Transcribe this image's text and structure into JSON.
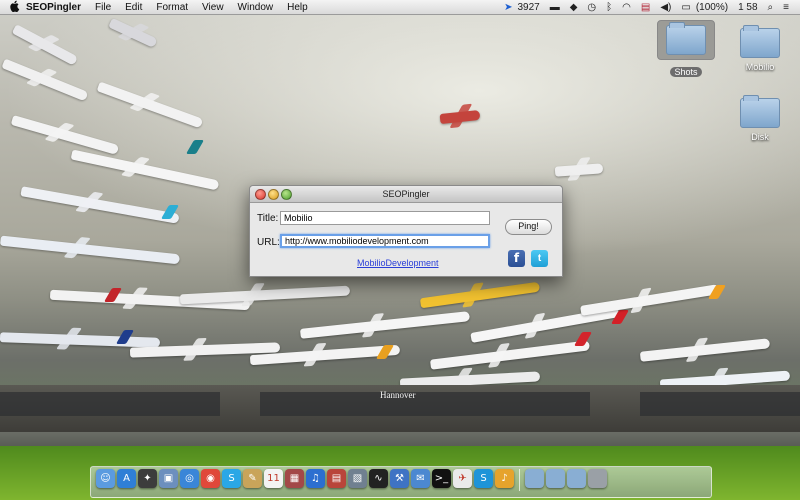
{
  "menubar": {
    "app_name": "SEOPingler",
    "items": [
      "File",
      "Edit",
      "Format",
      "View",
      "Window",
      "Help"
    ],
    "status": {
      "location_count": "3927",
      "battery": "(100%)",
      "time": "1 58"
    }
  },
  "desktop": {
    "icons": [
      {
        "label": "Shots",
        "selected": true
      },
      {
        "label": "Mobilio",
        "selected": false
      },
      {
        "label": "Disk",
        "selected": false
      }
    ],
    "wallpaper_text": "Hannover"
  },
  "window": {
    "title": "SEOPingler",
    "title_label": "Title:",
    "title_value": "Mobilio",
    "url_label": "URL:",
    "url_value": "http://www.mobiliodevelopment.com",
    "ping_label": "Ping!",
    "link_text": "MobilioDevelopment",
    "facebook_glyph": "f",
    "twitter_glyph": "t"
  },
  "dock": {
    "icons": [
      {
        "name": "finder-icon",
        "color": "#5b9be0",
        "glyph": "☺"
      },
      {
        "name": "app-store-icon",
        "color": "#2f7fd6",
        "glyph": "A"
      },
      {
        "name": "launchpad-icon",
        "color": "#3c3c3c",
        "glyph": "✦"
      },
      {
        "name": "photo-icon",
        "color": "#6c8fbe",
        "glyph": "▣"
      },
      {
        "name": "safari-icon",
        "color": "#3a86d8",
        "glyph": "◎"
      },
      {
        "name": "chrome-icon",
        "color": "#e0483a",
        "glyph": "◉"
      },
      {
        "name": "skype-icon",
        "color": "#2aa7e6",
        "glyph": "S"
      },
      {
        "name": "notes-icon",
        "color": "#c9a45a",
        "glyph": "✎"
      },
      {
        "name": "calendar-icon",
        "color": "#f3f3f3",
        "glyph": "11"
      },
      {
        "name": "photo-booth-icon",
        "color": "#a34848",
        "glyph": "▦"
      },
      {
        "name": "itunes-icon",
        "color": "#2c6fd0",
        "glyph": "♫"
      },
      {
        "name": "books-icon",
        "color": "#b9453a",
        "glyph": "▤"
      },
      {
        "name": "preview-icon",
        "color": "#708090",
        "glyph": "▧"
      },
      {
        "name": "activity-monitor-icon",
        "color": "#222222",
        "glyph": "∿"
      },
      {
        "name": "xcode-icon",
        "color": "#3f73c4",
        "glyph": "⚒"
      },
      {
        "name": "mail-icon",
        "color": "#4c88d1",
        "glyph": "✉"
      },
      {
        "name": "terminal-icon",
        "color": "#111111",
        "glyph": ">_"
      },
      {
        "name": "messages-icon",
        "color": "#eaeaea",
        "glyph": "✈"
      },
      {
        "name": "skype-blue-icon",
        "color": "#1e94d8",
        "glyph": "S"
      },
      {
        "name": "bell-icon",
        "color": "#e6a32c",
        "glyph": "♪"
      }
    ],
    "stack_icons": [
      {
        "name": "applications-folder-icon",
        "color": "#89aed3"
      },
      {
        "name": "documents-folder-icon",
        "color": "#89aed3"
      },
      {
        "name": "downloads-folder-icon",
        "color": "#89aed3"
      },
      {
        "name": "trash-icon",
        "color": "#9aa0a6"
      }
    ]
  }
}
